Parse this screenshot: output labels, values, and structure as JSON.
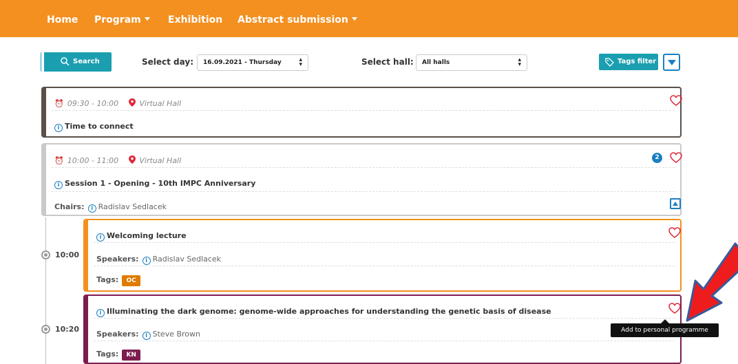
{
  "nav": {
    "items": [
      {
        "label": "Home",
        "caret": false
      },
      {
        "label": "Program",
        "caret": true
      },
      {
        "label": "Exhibition",
        "caret": false
      },
      {
        "label": "Abstract submission",
        "caret": true
      }
    ],
    "bg_color": "#f39020"
  },
  "toolbar": {
    "search_label": "Search",
    "day_label": "Select day:",
    "day_value": "16.09.2021 - Thursday",
    "hall_label": "Select hall:",
    "hall_value": "All halls",
    "tags_filter_label": "Tags filter",
    "accent_color": "#1b9fb0"
  },
  "sessions": [
    {
      "time": "09:30 - 10:00",
      "hall": "Virtual Hall",
      "title": "Time to connect",
      "border_color": "#5a5048"
    },
    {
      "time": "10:00 - 11:00",
      "hall": "Virtual Hall",
      "title": "Session 1 - Opening - 10th IMPC Anniversary",
      "chairs_label": "Chairs:",
      "chair": "Radislav Sedlacek",
      "count": "2",
      "border_color": "#c9c9c9"
    }
  ],
  "talks": [
    {
      "time": "10:00",
      "title": "Welcoming lecture",
      "speakers_label": "Speakers:",
      "speaker": "Radislav Sedlacek",
      "tags_label": "Tags:",
      "tag": "OC",
      "tag_color": "#e07b00",
      "border_color": "#f39020"
    },
    {
      "time": "10:20",
      "title": "Illuminating the dark genome: genome-wide approaches for understanding the genetic basis of disease",
      "speakers_label": "Speakers:",
      "speaker": "Steve Brown",
      "tags_label": "Tags:",
      "tag": "KN",
      "tag_color": "#7d1d4f",
      "border_color": "#7d1d4f"
    }
  ],
  "tooltip": "Add to personal programme",
  "icons": [
    "search-icon",
    "tag-icon",
    "alarm-clock-icon",
    "map-pin-icon",
    "info-icon",
    "heart-icon",
    "chevron-up-icon",
    "chevron-down-icon",
    "timeline-dot-icon",
    "annotation-arrow"
  ]
}
